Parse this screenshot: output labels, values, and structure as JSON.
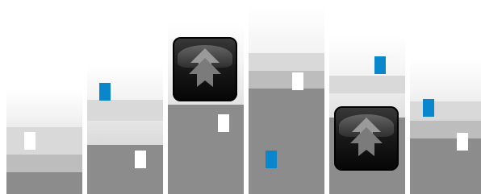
{
  "game": {
    "colors": {
      "background": "#ffffff",
      "block_white": "#ffffff",
      "block_blue": "#0a86cc",
      "band_light": "#d9d9d9",
      "band_mid": "#bdbdbd",
      "band_dark": "#8c8c8c",
      "tile_dark": "#111111"
    },
    "columns": [
      {
        "id": 1,
        "white_blocks": 1,
        "blue_blocks": 0,
        "has_upgrade_tile": false
      },
      {
        "id": 2,
        "white_blocks": 1,
        "blue_blocks": 1,
        "has_upgrade_tile": false
      },
      {
        "id": 3,
        "white_blocks": 1,
        "blue_blocks": 0,
        "has_upgrade_tile": true
      },
      {
        "id": 4,
        "white_blocks": 1,
        "blue_blocks": 1,
        "has_upgrade_tile": false
      },
      {
        "id": 5,
        "white_blocks": 0,
        "blue_blocks": 1,
        "has_upgrade_tile": true
      },
      {
        "id": 6,
        "white_blocks": 1,
        "blue_blocks": 1,
        "has_upgrade_tile": false
      }
    ],
    "icons": {
      "upgrade_tile": "double-up-arrow-icon"
    }
  }
}
